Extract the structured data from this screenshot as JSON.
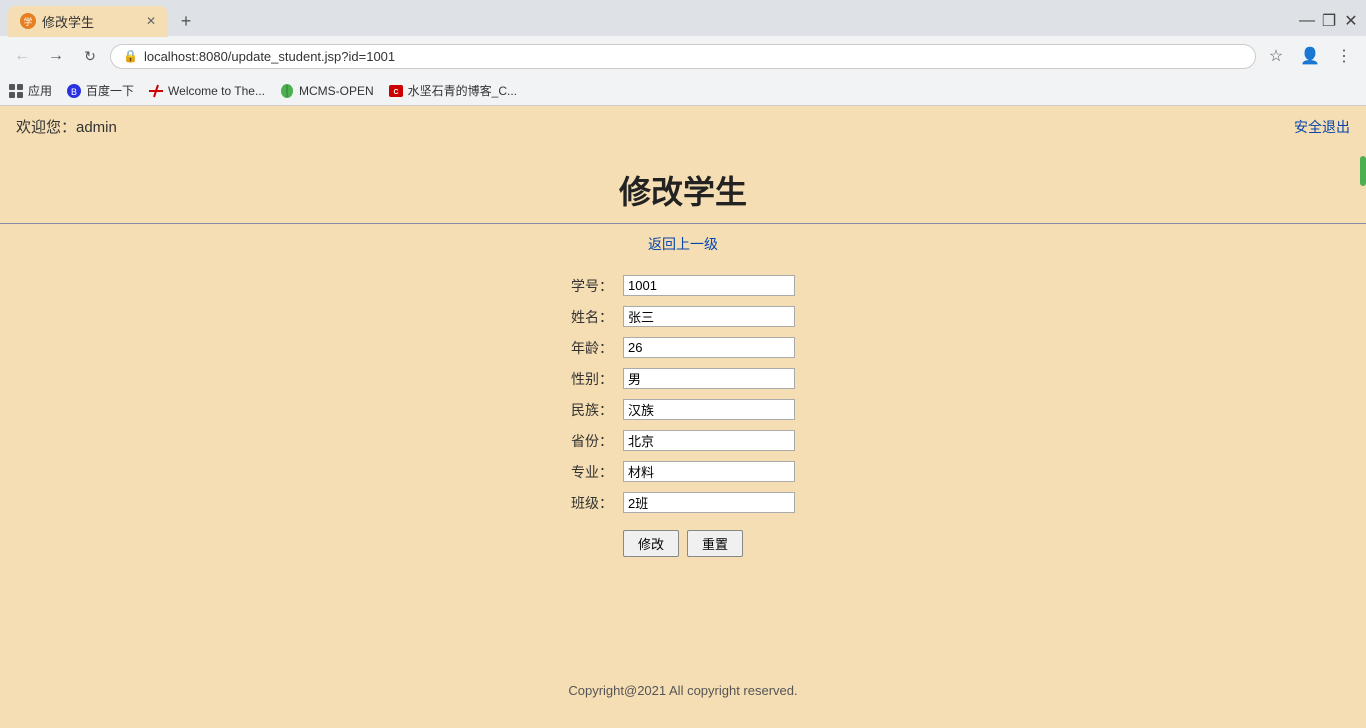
{
  "browser": {
    "tab_title": "修改学生",
    "url": "localhost:8080/update_student.jsp?id=1001",
    "bookmarks": [
      {
        "label": "应用",
        "icon": "grid"
      },
      {
        "label": "百度一下",
        "icon": "baidu"
      },
      {
        "label": "Welcome to The...",
        "icon": "slash"
      },
      {
        "label": "MCMS-OPEN",
        "icon": "leaf"
      },
      {
        "label": "水坚石青的博客_C...",
        "icon": "csdn"
      }
    ],
    "controls": {
      "minimize": "—",
      "maximize": "❐",
      "close": "✕"
    }
  },
  "page": {
    "welcome": "欢迎您：admin",
    "logout": "安全退出",
    "title": "修改学生",
    "back_link": "返回上一级",
    "form": {
      "fields": [
        {
          "label": "学号：",
          "name": "student_id",
          "value": "1001"
        },
        {
          "label": "姓名：",
          "name": "name",
          "value": "张三"
        },
        {
          "label": "年龄：",
          "name": "age",
          "value": "26"
        },
        {
          "label": "性别：",
          "name": "gender",
          "value": "男"
        },
        {
          "label": "民族：",
          "name": "ethnicity",
          "value": "汉族"
        },
        {
          "label": "省份：",
          "name": "province",
          "value": "北京"
        },
        {
          "label": "专业：",
          "name": "major",
          "value": "材料"
        },
        {
          "label": "班级：",
          "name": "class",
          "value": "2班"
        }
      ],
      "submit_btn": "修改",
      "reset_btn": "重置"
    },
    "footer": "Copyright@2021 All copyright reserved."
  }
}
